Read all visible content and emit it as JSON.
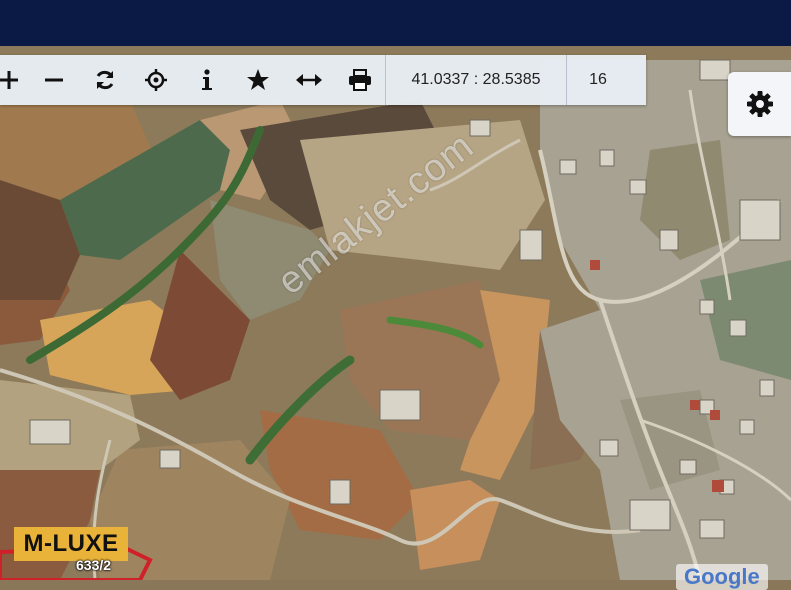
{
  "toolbar": {
    "buttons": [
      {
        "name": "zoom-in",
        "icon": "plus-icon"
      },
      {
        "name": "zoom-out",
        "icon": "minus-icon"
      },
      {
        "name": "refresh",
        "icon": "refresh-icon"
      },
      {
        "name": "locate",
        "icon": "crosshair-icon"
      },
      {
        "name": "info",
        "icon": "info-icon"
      },
      {
        "name": "favorite",
        "icon": "star-icon"
      },
      {
        "name": "measure",
        "icon": "arrows-horizontal-icon"
      },
      {
        "name": "print",
        "icon": "printer-icon"
      }
    ],
    "coordinates": "41.0337 : 28.5385",
    "zoom_level": "16"
  },
  "settings": {
    "icon": "gear-icon"
  },
  "watermark": "emlakjet.com",
  "brand_badge": "M-LUXE",
  "parcel_label": "633/2",
  "attribution": "Google",
  "colors": {
    "topbar": "#0b1a45",
    "toolbar_bg": "#e8eef6",
    "badge": "#e9b238",
    "parcel_outline": "#d0202a"
  }
}
